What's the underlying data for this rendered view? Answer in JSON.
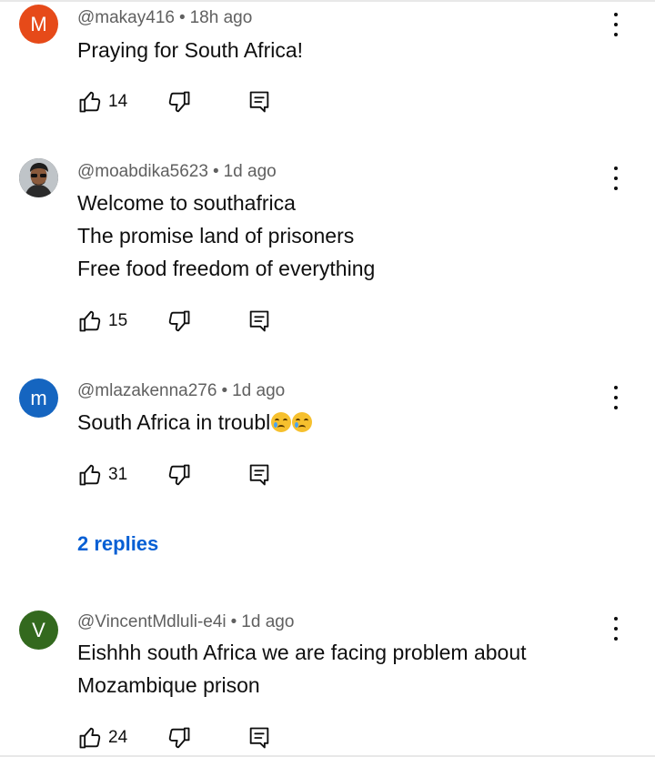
{
  "comments": [
    {
      "avatar_letter": "M",
      "avatar_color": "#e64a19",
      "handle": "@makay416",
      "time": "18h ago",
      "lines": [
        "Praying for South Africa!"
      ],
      "likes": "14"
    },
    {
      "avatar_letter": "",
      "avatar_color": "#3a3a3a",
      "handle": "@moabdika5623",
      "time": "1d ago",
      "lines": [
        "Welcome to southafrica",
        "The promise land of prisoners",
        "Free food freedom of everything"
      ],
      "likes": "15"
    },
    {
      "avatar_letter": "m",
      "avatar_color": "#1565c0",
      "handle": "@mlazakenna276",
      "time": "1d ago",
      "lines": [
        "South Africa in troubl"
      ],
      "emoji": "crying-face",
      "likes": "31",
      "replies_label": "2 replies"
    },
    {
      "avatar_letter": "V",
      "avatar_color": "#33691e",
      "handle": "@VincentMdluli-e4i",
      "time": "1d ago",
      "lines": [
        "Eishhh south Africa we are facing problem about",
        "Mozambique prison"
      ],
      "likes": "24"
    }
  ],
  "separator": "•",
  "icons": {
    "like": "thumbs-up-icon",
    "dislike": "thumbs-down-icon",
    "reply": "reply-comment-icon",
    "menu": "more-vert-icon"
  }
}
